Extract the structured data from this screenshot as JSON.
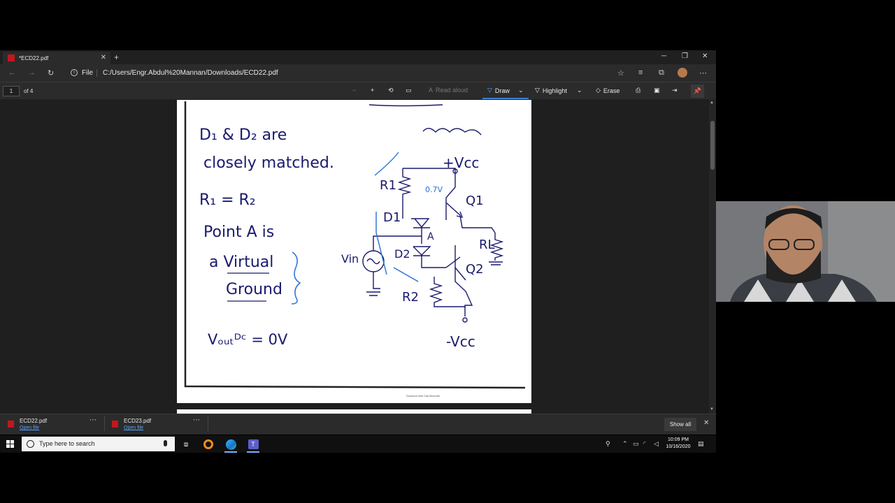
{
  "browser": {
    "tab_title": "*ECD22.pdf",
    "url_scheme_label": "File",
    "url": "C:/Users/Engr.Abdul%20Mannan/Downloads/ECD22.pdf"
  },
  "pdf_toolbar": {
    "page_number": "1",
    "page_of": "of 4",
    "read_aloud": "Read aloud",
    "draw": "Draw",
    "highlight": "Highlight",
    "erase": "Erase"
  },
  "document": {
    "bullets": [
      "D₁ & D₂ are",
      "closely matched.",
      "R₁ = R₂",
      "Point A is",
      "a Virtual",
      "Ground",
      "Vₒᵤₜᴰᶜ = 0V"
    ],
    "circuit_labels": [
      "+Vcc",
      "R1",
      "0.7V",
      "Q1",
      "D1",
      "A",
      "D2",
      "Vin",
      "RL",
      "Q2",
      "R2",
      "-Vcc"
    ],
    "footer": "Scanned with CamScanner"
  },
  "downloads": [
    {
      "name": "ECD22.pdf",
      "action": "Open file"
    },
    {
      "name": "ECD23.pdf",
      "action": "Open file"
    }
  ],
  "downloads_show_all": "Show all",
  "taskbar": {
    "search_placeholder": "Type here to search",
    "time": "10:09 PM",
    "date": "10/16/2020"
  },
  "colors": {
    "accent": "#3b82d6",
    "ink": "#1a1a6e",
    "annotation": "#2a6fd6"
  }
}
